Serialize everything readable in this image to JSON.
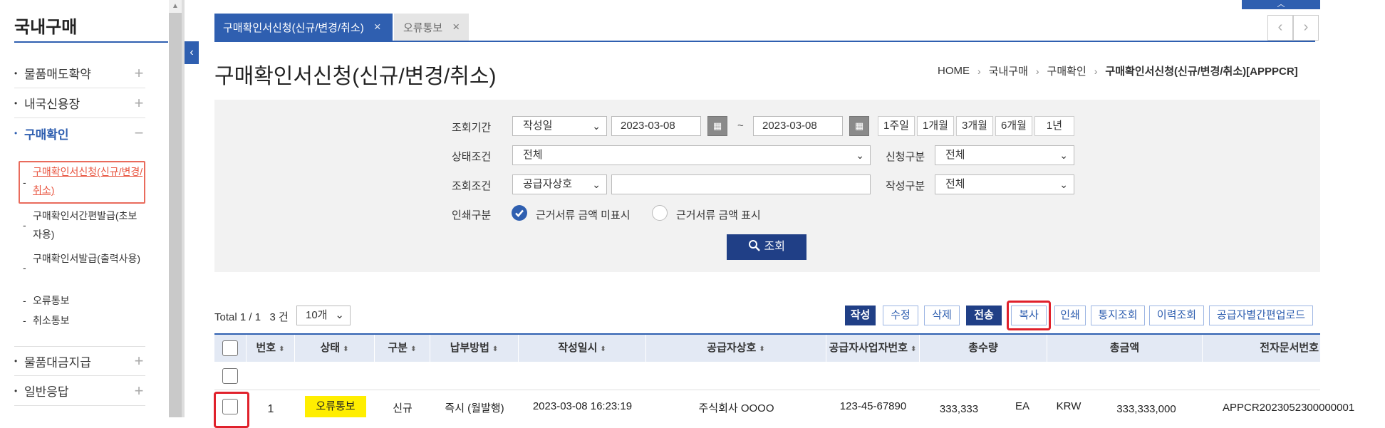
{
  "sidebar": {
    "title": "국내구매",
    "menus": [
      {
        "label": "물품매도확약",
        "sign": "+"
      },
      {
        "label": "내국신용장",
        "sign": "+"
      },
      {
        "label": "구매확인",
        "sign": "−"
      },
      {
        "label": "물품대금지급",
        "sign": "+"
      },
      {
        "label": "일반응답",
        "sign": "+"
      }
    ],
    "submenu": [
      {
        "label": "구매확인서신청(신규/변경/취소)"
      },
      {
        "label": "구매확인서간편발급(초보자용)"
      },
      {
        "label": "구매확인서발급(출력사용)"
      },
      {
        "label": "오류통보"
      },
      {
        "label": "취소통보"
      }
    ],
    "toggle_icon": "‹",
    "scroll_up": "▲"
  },
  "tabs": [
    {
      "label": "구매확인서신청(신규/변경/취소)",
      "close": "×"
    },
    {
      "label": "오류통보",
      "close": "×"
    }
  ],
  "nav": {
    "prev": "‹",
    "next": "›",
    "top": "︿"
  },
  "page": {
    "title": "구매확인서신청(신규/변경/취소)",
    "breadcrumb": [
      "HOME",
      "국내구매",
      "구매확인",
      "구매확인서신청(신규/변경/취소)[APPPCR]"
    ],
    "breadcrumb_sep": "›"
  },
  "search": {
    "period_label": "조회기간",
    "period_type": "작성일",
    "date_from": "2023-03-08",
    "date_tilde": "~",
    "date_to": "2023-03-08",
    "periods": [
      "1주일",
      "1개월",
      "3개월",
      "6개월",
      "1년"
    ],
    "status_label": "상태조건",
    "status_value": "전체",
    "apply_type_label": "신청구분",
    "apply_type_value": "전체",
    "query_label": "조회조건",
    "query_type": "공급자상호",
    "query_value": "",
    "write_type_label": "작성구분",
    "write_type_value": "전체",
    "print_label": "인쇄구분",
    "print_opt1": "근거서류 금액 미표시",
    "print_opt2": "근거서류 금액 표시",
    "search_btn": "조회",
    "caret": "⌄",
    "cal_icon": "▦"
  },
  "toolbar": {
    "total": "Total 1 / 1   3 건",
    "page_size": "10개",
    "buttons": [
      "작성",
      "수정",
      "삭제",
      "전송",
      "복사",
      "인쇄",
      "통지조회",
      "이력조회",
      "공급자별간편업로드"
    ]
  },
  "table": {
    "headers": [
      "번호",
      "상태",
      "구분",
      "납부방법",
      "작성일시",
      "공급자상호",
      "공급자사업자번호",
      "총수량",
      "총금액",
      "전자문서번호"
    ],
    "sort_icon": "⬍",
    "rows": [
      {
        "no": "1",
        "status": "오류통보",
        "type": "신규",
        "pay": "즉시 (월발행)",
        "date": "2023-03-08 16:23:19",
        "supplier": "주식회사 OOOO",
        "biz_no": "123-45-67890",
        "qty": "333,333",
        "unit": "EA",
        "currency": "KRW",
        "amount": "333,333,000",
        "doc_no": "APPCR2023052300000001"
      }
    ]
  },
  "colors": {
    "primary": "#2f5fb0",
    "dark": "#203f86",
    "highlight": "#e0212b",
    "badge": "#ffee00"
  }
}
